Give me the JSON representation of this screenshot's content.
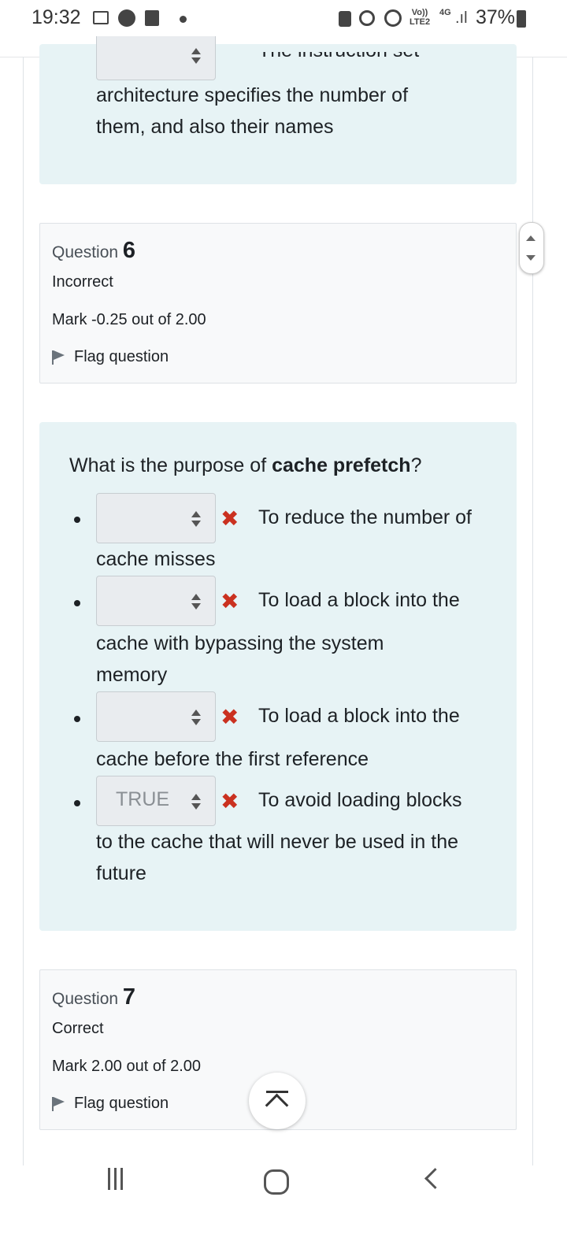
{
  "status_bar": {
    "time": "19:32",
    "network_top": "Vo))",
    "network_bottom": "LTE2",
    "network_type": "4G",
    "battery": "37%",
    "icons": [
      "image-icon",
      "messenger-icon",
      "doc-icon",
      "dot-icon",
      "lock-icon",
      "alarm-icon",
      "hotspot-icon",
      "signal-icon",
      "battery-icon"
    ]
  },
  "prev_question": {
    "cut_text": "The instruction set",
    "line1": "architecture specifies the number of",
    "line2": "them, and also their names"
  },
  "question6": {
    "label": "Question",
    "number": "6",
    "state": "Incorrect",
    "mark": "Mark -0.25 out of 2.00",
    "flag": "Flag question",
    "text_before": "What is the purpose of ",
    "text_bold": "cache prefetch",
    "text_after": "?",
    "answers": [
      {
        "selected": "",
        "first": "To reduce the number of",
        "rest": [
          "cache misses"
        ]
      },
      {
        "selected": "",
        "first": "To load a block into the",
        "rest": [
          "cache with bypassing the system",
          "memory"
        ]
      },
      {
        "selected": "",
        "first": "To load a block into the",
        "rest": [
          "cache before the first reference"
        ]
      },
      {
        "selected": "TRUE",
        "first": "To avoid loading blocks",
        "rest": [
          "to the cache that will never be used in the",
          "future"
        ]
      }
    ]
  },
  "question7": {
    "label": "Question",
    "number": "7",
    "state": "Correct",
    "mark": "Mark 2.00 out of 2.00",
    "flag": "Flag question"
  },
  "colors": {
    "qtext_bg": "#e7f3f5",
    "incorrect": "#ca3120",
    "info_bg": "#f8f9fa"
  }
}
